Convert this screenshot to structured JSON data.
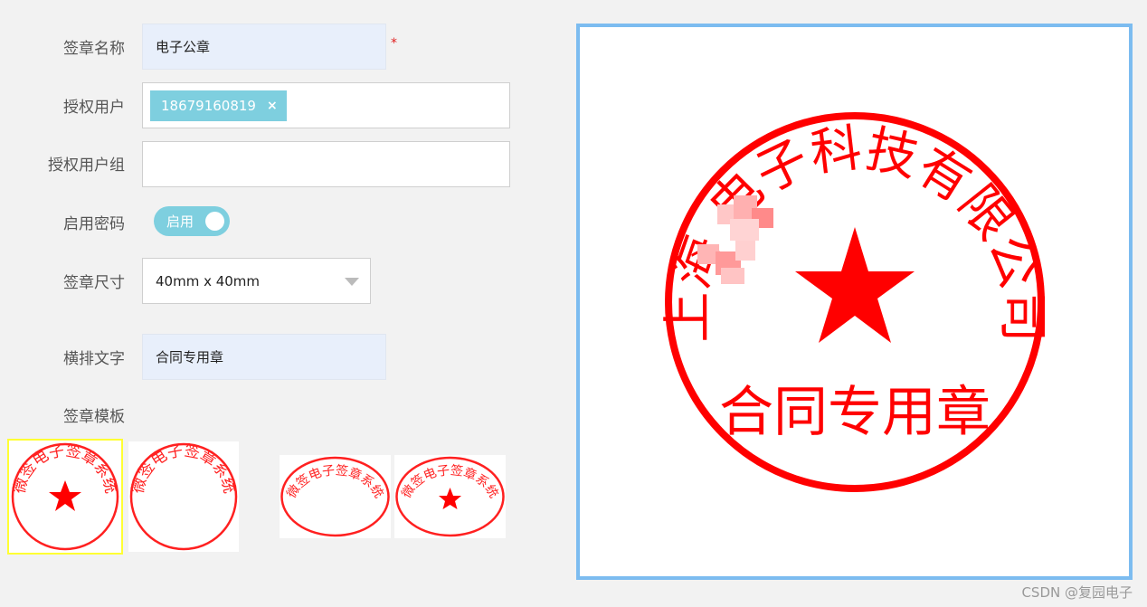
{
  "form": {
    "name": {
      "label": "签章名称",
      "value": "电子公章",
      "required_mark": "*"
    },
    "auth_user": {
      "label": "授权用户",
      "tag": "18679160819",
      "tag_remove": "×"
    },
    "auth_group": {
      "label": "授权用户组",
      "value": ""
    },
    "password": {
      "label": "启用密码",
      "toggle_label": "启用",
      "enabled": true
    },
    "size": {
      "label": "签章尺寸",
      "value": "40mm x 40mm"
    },
    "horizontal_text": {
      "label": "横排文字",
      "value": "合同专用章"
    },
    "templates": {
      "label": "签章模板",
      "items": [
        {
          "text": "微签电子签章系统",
          "shape": "circle",
          "star": true,
          "selected": true
        },
        {
          "text": "微签电子签章系统",
          "shape": "circle",
          "star": false,
          "selected": false
        },
        {
          "text": "微签电子签章系统",
          "shape": "ellipse",
          "star": false,
          "selected": false
        },
        {
          "text": "微签电子签章系统",
          "shape": "ellipse",
          "star": true,
          "selected": false
        }
      ]
    }
  },
  "preview": {
    "arc_text": "上海  电子科技有限公司",
    "center_text": "合同专用章"
  },
  "watermark": "CSDN @复园电子",
  "colors": {
    "accent": "#7ecfdf",
    "seal": "#ff0000",
    "preview_border": "#7cbcf0",
    "selected_border": "#ffff33"
  }
}
